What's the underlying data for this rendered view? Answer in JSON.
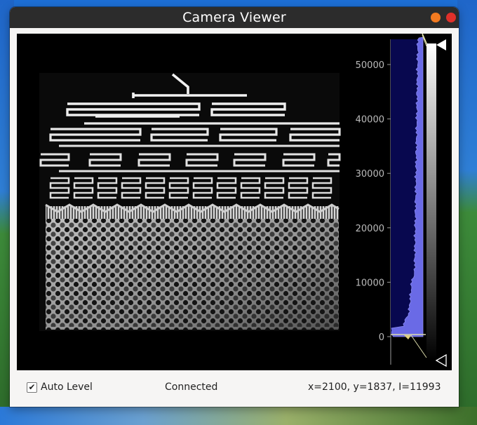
{
  "window": {
    "title": "Camera Viewer"
  },
  "histogram": {
    "axis_ticks": [
      "50000",
      "40000",
      "30000",
      "20000",
      "10000",
      "0"
    ],
    "axis_values": [
      50000,
      40000,
      30000,
      20000,
      10000,
      0
    ],
    "axis_max": 55000
  },
  "status": {
    "auto_level_label": "Auto Level",
    "auto_level_checked": true,
    "connection": "Connected",
    "cursor_readout": "x=2100, y=1837, I=11993"
  },
  "colors": {
    "histogram_fill": "#6a6ae6",
    "histogram_bg": "#08084f",
    "title_bar": "#2c2c2c",
    "minimize": "#f27a20",
    "close": "#e0302a"
  }
}
